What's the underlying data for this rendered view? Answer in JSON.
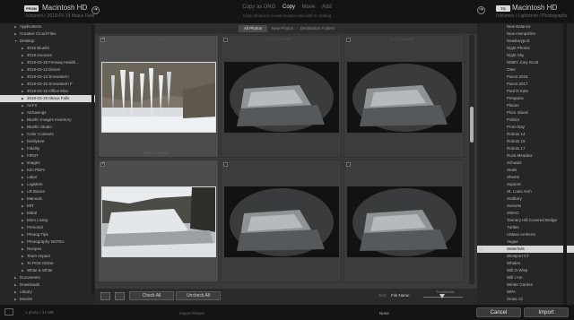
{
  "source": {
    "badge": "FROM",
    "name": "Macintosh HD",
    "path": "/Volumes / 2018-03-19 Ithaca Falls"
  },
  "destination": {
    "badge": "TO",
    "name": "Macintosh HD",
    "path": "/Volumes / Lightroom / Photographs"
  },
  "modes": {
    "items": [
      "Copy as DNG",
      "Copy",
      "Move",
      "Add"
    ],
    "active": "Copy",
    "subtitle": "Copy photos to a new location and add to catalog"
  },
  "left_tree": [
    {
      "indent": 1,
      "label": "Applications",
      "expanded": false
    },
    {
      "indent": 1,
      "label": "Creative Cloud Files",
      "expanded": false
    },
    {
      "indent": 1,
      "label": "Desktop",
      "expanded": true
    },
    {
      "indent": 2,
      "label": "2016 Bluefin",
      "expanded": false
    },
    {
      "indent": 2,
      "label": "2018 Invoices",
      "expanded": false
    },
    {
      "indent": 2,
      "label": "2018-03-19 Fenway Health...",
      "expanded": false
    },
    {
      "indent": 2,
      "label": "2018-03-13 Dinner",
      "expanded": false
    },
    {
      "indent": 2,
      "label": "2018-03-13 Snowstorm",
      "expanded": false
    },
    {
      "indent": 2,
      "label": "2018-03-15 Snowstorm F",
      "expanded": false
    },
    {
      "indent": 2,
      "label": "2018-03-16 Office Misc",
      "expanded": false
    },
    {
      "indent": 2,
      "label": "2018-03-19 Ithaca Falls",
      "expanded": false,
      "selected": true
    },
    {
      "indent": 2,
      "label": "AVFX",
      "expanded": false
    },
    {
      "indent": 2,
      "label": "AirSavings",
      "expanded": false
    },
    {
      "indent": 2,
      "label": "Bluefin Images Inventory",
      "expanded": false
    },
    {
      "indent": 2,
      "label": "Bluefin Studio",
      "expanded": false
    },
    {
      "indent": 2,
      "label": "Color Contexts",
      "expanded": false
    },
    {
      "indent": 2,
      "label": "familytree",
      "expanded": false
    },
    {
      "indent": 2,
      "label": "Fidelity",
      "expanded": false
    },
    {
      "indent": 2,
      "label": "FIRST",
      "expanded": false
    },
    {
      "indent": 2,
      "label": "images",
      "expanded": false
    },
    {
      "indent": 2,
      "label": "Kim PDFs",
      "expanded": false
    },
    {
      "indent": 2,
      "label": "Labor",
      "expanded": false
    },
    {
      "indent": 2,
      "label": "LogMeIn",
      "expanded": false
    },
    {
      "indent": 2,
      "label": "LR Basics",
      "expanded": false
    },
    {
      "indent": 2,
      "label": "Manuals",
      "expanded": false
    },
    {
      "indent": 2,
      "label": "MIT",
      "expanded": false
    },
    {
      "indent": 2,
      "label": "Mitral",
      "expanded": false
    },
    {
      "indent": 2,
      "label": "Mom Living",
      "expanded": false
    },
    {
      "indent": 2,
      "label": "Personal",
      "expanded": false
    },
    {
      "indent": 2,
      "label": "Photog Tips",
      "expanded": false
    },
    {
      "indent": 2,
      "label": "Photography NOTEs",
      "expanded": false
    },
    {
      "indent": 2,
      "label": "Recipes",
      "expanded": false
    },
    {
      "indent": 2,
      "label": "Team Impact",
      "expanded": false
    },
    {
      "indent": 2,
      "label": "To Print Online",
      "expanded": false
    },
    {
      "indent": 2,
      "label": "White & White",
      "expanded": false
    },
    {
      "indent": 1,
      "label": "Documents",
      "expanded": false
    },
    {
      "indent": 1,
      "label": "Downloads",
      "expanded": false
    },
    {
      "indent": 1,
      "label": "Library",
      "expanded": false
    },
    {
      "indent": 1,
      "label": "Movies",
      "expanded": false
    },
    {
      "indent": 1,
      "label": "Music",
      "expanded": false
    }
  ],
  "dest_tree": [
    {
      "label": "New Balance"
    },
    {
      "label": "New Hampshire"
    },
    {
      "label": "Newburyport"
    },
    {
      "label": "Night Photos"
    },
    {
      "label": "Night Sky"
    },
    {
      "label": "NMBY Joey Scott"
    },
    {
      "label": "Otter"
    },
    {
      "label": "Parrot 2016"
    },
    {
      "label": "Parrot 2017"
    },
    {
      "label": "Paul N Kate"
    },
    {
      "label": "Penguins"
    },
    {
      "label": "Places"
    },
    {
      "label": "Plum Island"
    },
    {
      "label": "Politics"
    },
    {
      "label": "Prom Day"
    },
    {
      "label": "Robots 14"
    },
    {
      "label": "Robots 15"
    },
    {
      "label": "Robots 17"
    },
    {
      "label": "Rock Meadow"
    },
    {
      "label": "Schwalz"
    },
    {
      "label": "Seals"
    },
    {
      "label": "Sheets"
    },
    {
      "label": "Squirrel"
    },
    {
      "label": "St. Louis Arch"
    },
    {
      "label": "Sudbury"
    },
    {
      "label": "Sunsets"
    },
    {
      "label": "SWAG"
    },
    {
      "label": "Tannery Hill Covered Bridge"
    },
    {
      "label": "Turtles"
    },
    {
      "label": "UMass Amherst"
    },
    {
      "label": "Vegas"
    },
    {
      "label": "Waterfalls",
      "selected": true
    },
    {
      "label": "Westport CT"
    },
    {
      "label": "Whales"
    },
    {
      "label": "Will O Wisp"
    },
    {
      "label": "Will I Am"
    },
    {
      "label": "Winter Garden"
    },
    {
      "label": "WPA"
    },
    {
      "label": "Xmas 12"
    },
    {
      "label": "Zoo"
    }
  ],
  "filter_tabs": [
    "All Photos",
    "New Photos",
    "Destination Folders"
  ],
  "grid": {
    "cells": [
      {
        "index": "DSC07177.NEF",
        "checked": true,
        "selected": true,
        "filename": "DSC07178.NEF",
        "variant": "icicle"
      },
      {
        "index": "DSC07179.NEF",
        "checked": false,
        "selected": false,
        "filename": "",
        "variant": "falls-dark"
      },
      {
        "index": "DSC07180.NEF",
        "checked": false,
        "selected": false,
        "filename": "",
        "variant": "falls-dark"
      },
      {
        "index": "DSC07181.NEF",
        "checked": true,
        "selected": true,
        "filename": "",
        "variant": "falls-bright"
      },
      {
        "index": "",
        "checked": false,
        "selected": false,
        "filename": "",
        "variant": "falls-dark"
      },
      {
        "index": "",
        "checked": false,
        "selected": false,
        "filename": "",
        "variant": "falls-dark"
      }
    ]
  },
  "toolbar": {
    "check_all": "Check All",
    "uncheck_all": "Uncheck All",
    "sort_label": "Sort:",
    "sort_value": "File Name",
    "thumbnails_label": "Thumbnails"
  },
  "bottom": {
    "count_text": "1 photo / 34 MB",
    "import_preset_label": "Import Preset :",
    "import_preset_value": "None",
    "cancel_label": "Cancel",
    "import_label": "Import"
  },
  "colors": {
    "background": "#2a2a2a",
    "panel": "#262626",
    "selected_row": "#d8d8d8",
    "text": "#b9b9b9"
  }
}
